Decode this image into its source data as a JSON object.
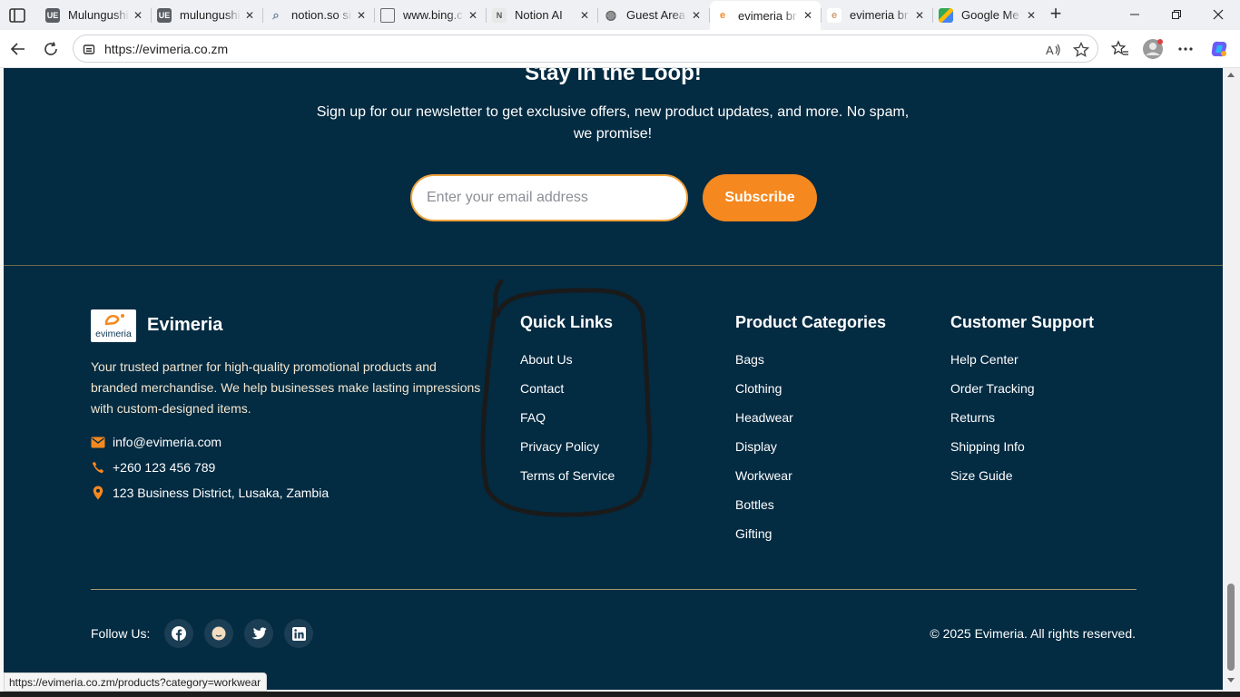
{
  "browser": {
    "tabs": [
      {
        "title": "Mulungushi",
        "icon": "ue-icon",
        "color": "#5a5f66"
      },
      {
        "title": "mulungushi",
        "icon": "ue-icon",
        "color": "#5a5f66"
      },
      {
        "title": "notion.so si",
        "icon": "search-icon",
        "color": "#6a7ea0"
      },
      {
        "title": "www.bing.c",
        "icon": "document-icon",
        "color": "#6b6b6b"
      },
      {
        "title": "Notion AI",
        "icon": "notion-icon",
        "color": "#8a8a8a"
      },
      {
        "title": "Guest Area",
        "icon": "globe-icon",
        "color": "#666666"
      },
      {
        "title": "evimeria br",
        "icon": "evimeria-icon",
        "color": "#f5881f"
      },
      {
        "title": "evimeria br",
        "icon": "evimeria-icon",
        "color": "#c9a274"
      },
      {
        "title": "Google Me",
        "icon": "maps-icon",
        "color": "#34a853"
      }
    ],
    "active_tab_index": 6,
    "url": "https://evimeria.co.zm",
    "status_url": "https://evimeria.co.zm/products?category=workwear"
  },
  "newsletter": {
    "title": "Stay in the Loop!",
    "description": "Sign up for our newsletter to get exclusive offers, new product updates, and more. No spam, we promise!",
    "email_placeholder": "Enter your email address",
    "email_value": "",
    "subscribe_label": "Subscribe"
  },
  "brand": {
    "logo_text": "evimeria",
    "name": "Evimeria",
    "description": "Your trusted partner for high-quality promotional products and branded merchandise. We help businesses make lasting impressions with custom-designed items.",
    "email": "info@evimeria.com",
    "phone": "+260 123 456 789",
    "address": "123 Business District, Lusaka, Zambia"
  },
  "columns": {
    "quick_links": {
      "title": "Quick Links",
      "links": [
        "About Us",
        "Contact",
        "FAQ",
        "Privacy Policy",
        "Terms of Service"
      ]
    },
    "product_categories": {
      "title": "Product Categories",
      "links": [
        "Bags",
        "Clothing",
        "Headwear",
        "Display",
        "Workwear",
        "Bottles",
        "Gifting"
      ]
    },
    "customer_support": {
      "title": "Customer Support",
      "links": [
        "Help Center",
        "Order Tracking",
        "Returns",
        "Shipping Info",
        "Size Guide"
      ]
    }
  },
  "footer": {
    "follow_label": "Follow Us:",
    "social": [
      "facebook-icon",
      "emoji-icon",
      "twitter-icon",
      "linkedin-icon"
    ],
    "copyright": "© 2025 Evimeria. All rights reserved."
  },
  "colors": {
    "page_bg": "#032b42",
    "accent": "#f5881f",
    "input_border": "#f0a33c"
  }
}
